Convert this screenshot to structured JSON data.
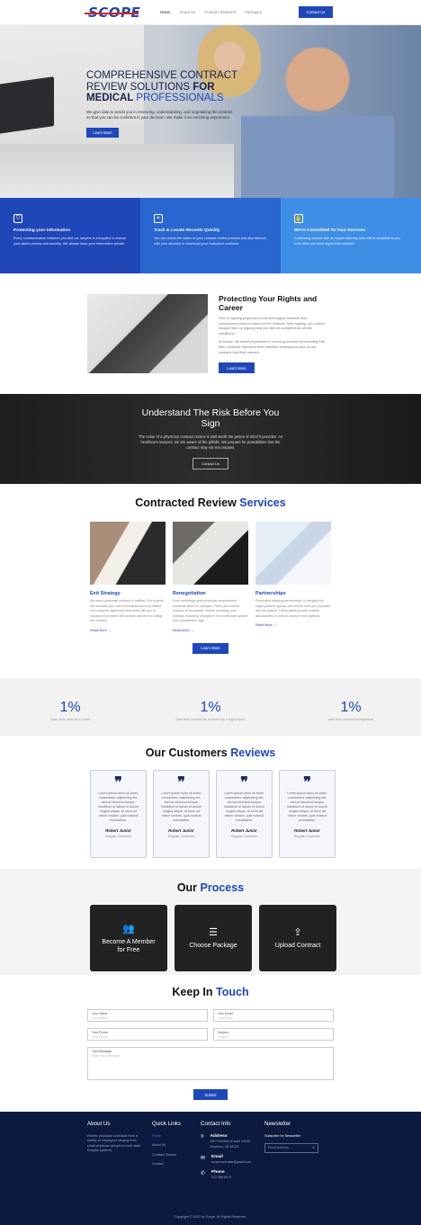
{
  "nav": {
    "logo": "SCOPE",
    "links": [
      "Home",
      "About Us",
      "Contract Review",
      "Packages"
    ],
    "cta": "Contact Us"
  },
  "hero": {
    "title_1": "Comprehensive Contract",
    "title_2": "Review Solutions ",
    "title_3": "for",
    "title_4": "Medical ",
    "title_5": "Professionals",
    "body": "We give data to assist you in reviewing, understanding, and negotiating the contract so that you can be confident in your decision. We make it an enriching experience.",
    "button": "Learn More"
  },
  "features": [
    {
      "icon": "shield-icon",
      "title": "Protecting your Information",
      "body": "Every communication between you and our lawyers is encrypted to ensure your data's privacy and security. We always keep your information private."
    },
    {
      "icon": "location-icon",
      "title": "Track & Locate Records Quickly",
      "body": "You can check the status of your contract review process and also interact with your attorney or download your evaluated contracts."
    },
    {
      "icon": "handshake-icon",
      "title": "We're Committed To Your Services",
      "body": "Continuing contact with an expert attorney who will be available to you even after you have signed the contract."
    }
  ],
  "protect": {
    "title": "Protecting Your Rights and Career",
    "p1": "Prior to signing physicians must thoroughly research and comprehend each provision of the contract. After signing, you cannot escape from by arguing that you did not comprehend certain conditions.",
    "p2": "At Scope, we assist physicians in removing sources by ensuring that their contracts represent their intended employment and do not contains that their careers.",
    "button": "Learn More"
  },
  "risk": {
    "title": "Understand The Risk Before You Sign",
    "body": "The value of a physician contract review is well worth the peace of mind it provides. As healthcare lawyers, we are aware of the pitfalls. We prepare for possibilities that the contract may not encompass.",
    "button": "Contact Us"
  },
  "services": {
    "title": "Contracted Review ",
    "title_accent": "Services",
    "cards": [
      {
        "title": "Exit Strategy",
        "body": "Not every physician contract is fulfilled. Our experts will evaluate your current contract and any related non-compete agreement that meet with you to explain the problem and provide options for exiting the contract.",
        "link": "Read More"
      },
      {
        "title": "Renegotiation",
        "body": "Even seemingly good physician employment contracts allow for changes. There are several reasons to reconsider. Before renewing, your contract, including changes in the healthcare system and a physician's age.",
        "link": "Read More"
      },
      {
        "title": "Partnerships",
        "body": "Physicians seeking partnerships or merging into larger practice groups can benefit both the physician and the patient. These paths include positive associations in order to accept more patients.",
        "link": "Read More"
      }
    ],
    "button": "Learn More"
  },
  "stats": [
    {
      "value": "1%",
      "label": "lower their contract is unfair"
    },
    {
      "value": "1%",
      "label": "want their contract be reviewed by a legal expert"
    },
    {
      "value": "1%",
      "label": "want their contract renegotiated"
    }
  ],
  "reviews": {
    "title": "Our Customers ",
    "title_accent": "Reviews",
    "items": [
      {
        "text": "Lorem ipsum dolor sit amet, consectetur adipisicing elit, sed do eiusmod tempor incididunt ut labore et dolore magna aliqua. Ut enim ad minim veniam, quis nostrud exercitation.",
        "name": "Robert Junior",
        "role": "Regular Customer"
      },
      {
        "text": "Lorem ipsum dolor sit amet, consectetur adipisicing elit, sed do eiusmod tempor incididunt ut labore et dolore magna aliqua. Ut enim ad minim veniam, quis nostrud exercitation.",
        "name": "Robert Junior",
        "role": "Regular Customer"
      },
      {
        "text": "Lorem ipsum dolor sit amet, consectetur adipisicing elit, sed do eiusmod tempor incididunt ut labore et dolore magna aliqua. Ut enim ad minim veniam, quis nostrud exercitation.",
        "name": "Robert Junior",
        "role": "Regular Customer"
      },
      {
        "text": "Lorem ipsum dolor sit amet, consectetur adipisicing elit, sed do eiusmod tempor incididunt ut labore et dolore magna aliqua. Ut enim ad minim veniam, quis nostrud exercitation.",
        "name": "Robert Junior",
        "role": "Regular Customer"
      }
    ]
  },
  "process": {
    "title": "Our ",
    "title_accent": "Process",
    "items": [
      {
        "icon": "users-icon",
        "label": "Become A Member for Free"
      },
      {
        "icon": "layers-icon",
        "label": "Choose Package"
      },
      {
        "icon": "upload-icon",
        "label": "Upload Contract"
      }
    ]
  },
  "contact": {
    "title": "Keep In ",
    "title_accent": "Touch",
    "fields": {
      "name": {
        "label": "Your Name",
        "placeholder": "Your Name"
      },
      "email": {
        "label": "Your Email",
        "placeholder": "Your Email"
      },
      "phone": {
        "label": "Your Phone",
        "placeholder": "Your Phone"
      },
      "subject": {
        "label": "Subject",
        "placeholder": "Subject"
      },
      "message": {
        "label": "Your Message",
        "placeholder": "Enter your Message"
      }
    },
    "submit": "Submit"
  },
  "footer": {
    "about_title": "About Us",
    "about_body": "Review physician contracts from a variety of employers ranging from small physician groups to multi-state hospital systems.",
    "links_title": "Quick Links",
    "links": [
      "Home",
      "About Us",
      "Contract Review",
      "Contact"
    ],
    "contact_title": "Contact Info",
    "address_label": "Address",
    "address": "600 Freedom st suite #1000 Dearborn, MI 48124",
    "email_label": "Email",
    "email": "scopecontracts@gmail.com",
    "phone_label": "Phone",
    "phone": "313 386 8079",
    "newsletter_title": "Newsletter",
    "newsletter_label": "Subscribe for Newsletter",
    "newsletter_placeholder": "Email Address",
    "copyright": "Copyright © 2022 by Scope. All Rights Reserved."
  },
  "colors": {
    "primary": "#1f47b8",
    "footer": "#0b1a3e"
  }
}
